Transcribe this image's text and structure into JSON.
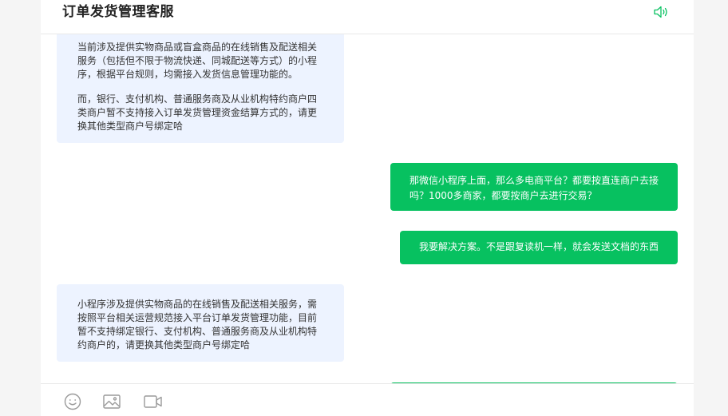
{
  "header": {
    "title": "订单发货管理客服",
    "speaker_icon": "speaker-icon"
  },
  "messages": [
    {
      "side": "left",
      "paragraphs": [
        "当前涉及提供实物商品或盲盒商品的在线销售及配送相关服务（包括但不限于物流快递、同城配送等方式）的小程序，根据平台规则，均需接入发货信息管理功能的。",
        "而，银行、支付机构、普通服务商及从业机构特约商户四类商户暂不支持接入订单发货管理资金结算方式的，请更换其他类型商户号绑定哈"
      ]
    },
    {
      "side": "right",
      "text": "那微信小程序上面，那么多电商平台？都要按直连商户去接吗？1000多商家，都要按商户去进行交易？"
    },
    {
      "side": "right",
      "text": "我要解决方案。不是跟复读机一样，就会发送文档的东西"
    },
    {
      "side": "left",
      "text": "小程序涉及提供实物商品的在线销售及配送相关服务，需按照平台相关运营规范接入平台订单发货管理功能，目前暂不支持绑定银行、支付机构、普通服务商及从业机构特约商户的，请更换其他类型商户号绑定哈"
    }
  ],
  "toolbar": {
    "icons": [
      "emoji-icon",
      "image-icon",
      "video-icon"
    ]
  },
  "colors": {
    "accent": "#07c160",
    "left_bubble": "#edf3ff",
    "speaker": "#07c160"
  }
}
